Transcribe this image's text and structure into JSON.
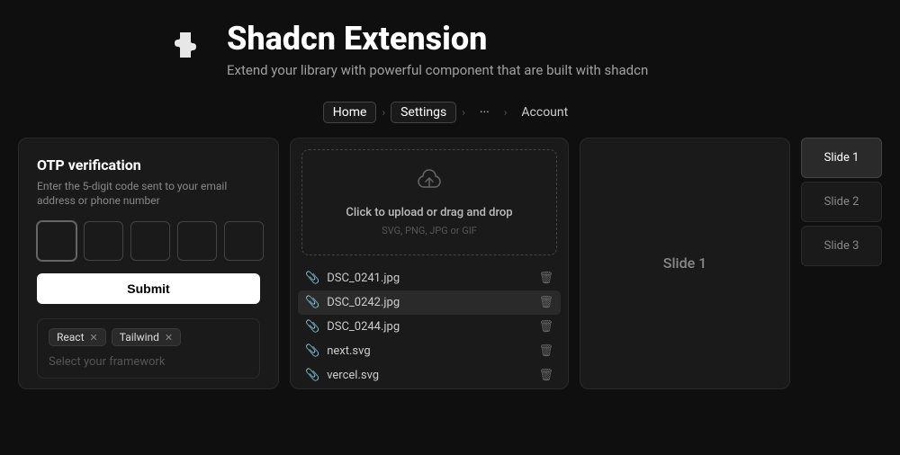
{
  "header": {
    "title": "Shadcn Extension",
    "subtitle": "Extend your library with powerful component that are built with shadcn",
    "puzzle_icon": "🧩"
  },
  "breadcrumb": {
    "items": [
      {
        "label": "Home",
        "active": true
      },
      {
        "label": "Settings",
        "active": true
      },
      {
        "label": "···",
        "active": false
      },
      {
        "label": "Account",
        "active": false
      }
    ]
  },
  "otp": {
    "title": "OTP verification",
    "description": "Enter the 5-digit code sent to your email address or phone number",
    "submit_label": "Submit",
    "digits": [
      "",
      "",
      "",
      "",
      ""
    ]
  },
  "tags": {
    "selected": [
      "React",
      "Tailwind"
    ],
    "placeholder": "Select your framework"
  },
  "upload": {
    "cta": "Click to upload",
    "cta_suffix": " or drag and drop",
    "formats": "SVG, PNG, JPG or GIF",
    "files": [
      {
        "name": "DSC_0241.jpg",
        "highlighted": false
      },
      {
        "name": "DSC_0242.jpg",
        "highlighted": true
      },
      {
        "name": "DSC_0244.jpg",
        "highlighted": false
      },
      {
        "name": "next.svg",
        "highlighted": false
      },
      {
        "name": "vercel.svg",
        "highlighted": false
      }
    ]
  },
  "carousel": {
    "current_slide": "Slide 1",
    "slides": [
      {
        "label": "Slide 1",
        "active": true
      },
      {
        "label": "Slide 2",
        "active": false
      },
      {
        "label": "Slide 3",
        "active": false
      }
    ]
  }
}
